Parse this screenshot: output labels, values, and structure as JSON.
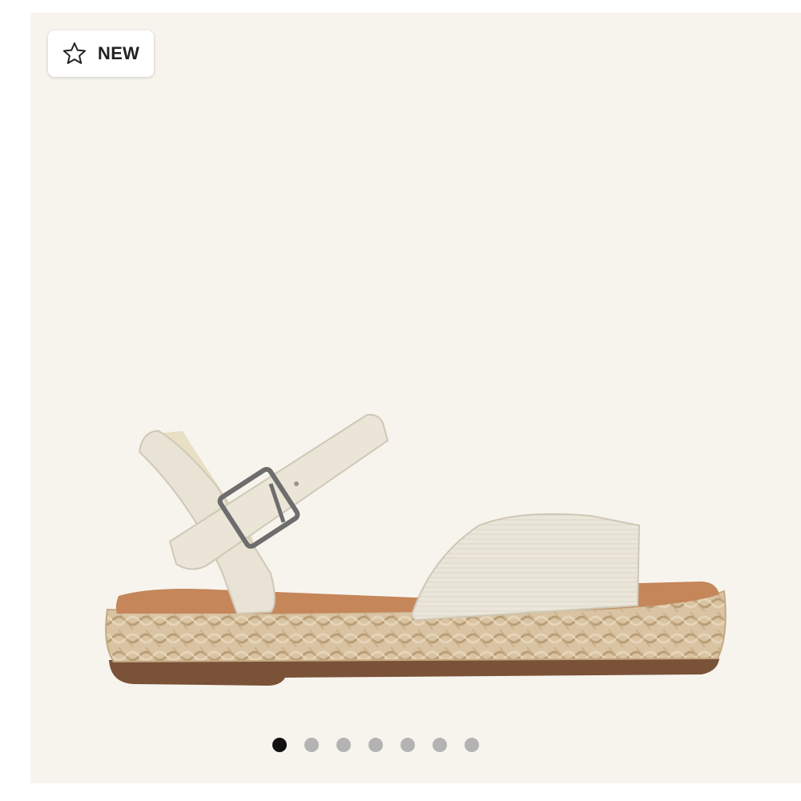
{
  "badge": {
    "label": "NEW",
    "icon": "star-outline-icon"
  },
  "product": {
    "image": "sandal-espadrille-platform"
  },
  "carousel": {
    "total": 7,
    "active_index": 0
  },
  "colors": {
    "background": "#f7f4ee",
    "dot_active": "#111111",
    "dot_inactive": "#b3b3b3"
  }
}
